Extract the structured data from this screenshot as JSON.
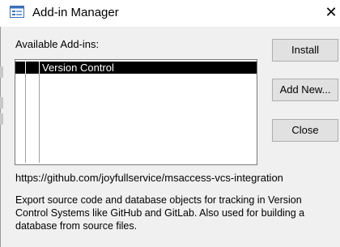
{
  "window": {
    "title": "Add-in Manager",
    "close_glyph": "✕",
    "icon": "add-in-manager-app-icon"
  },
  "available_label": "Available Add-ins:",
  "addins": [
    {
      "name": "Version Control",
      "selected": true
    }
  ],
  "buttons": {
    "install": "Install",
    "add_new": "Add New...",
    "close": "Close"
  },
  "details": {
    "url": "https://github.com/joyfullservice/msaccess-vcs-integration",
    "description": "Export source code and database objects for tracking in Version Control Systems like GitHub and GitLab. Also used for building a database from source files."
  },
  "colors": {
    "selection": "#000000",
    "dialog_bg": "#f0f0f0",
    "button_bg": "#e1e1e1"
  }
}
